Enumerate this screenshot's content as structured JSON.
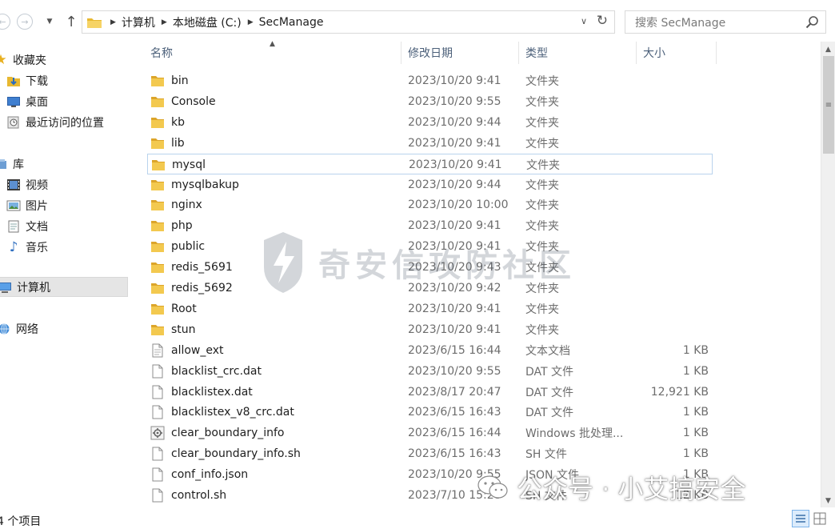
{
  "address": {
    "breadcrumbs": [
      "计算机",
      "本地磁盘 (C:)",
      "SecManage"
    ]
  },
  "search": {
    "placeholder": "搜索 SecManage"
  },
  "nav": {
    "items": [
      {
        "label": "收藏夹",
        "icon": "star-icon"
      },
      {
        "label": "下载",
        "icon": "download-folder-icon"
      },
      {
        "label": "桌面",
        "icon": "desktop-icon"
      },
      {
        "label": "最近访问的位置",
        "icon": "recent-places-icon"
      },
      {
        "label": "库",
        "icon": "library-icon"
      },
      {
        "label": "视频",
        "icon": "video-icon"
      },
      {
        "label": "图片",
        "icon": "pictures-icon"
      },
      {
        "label": "文档",
        "icon": "documents-icon"
      },
      {
        "label": "音乐",
        "icon": "music-icon"
      },
      {
        "label": "计算机",
        "icon": "computer-icon"
      },
      {
        "label": "网络",
        "icon": "network-icon"
      }
    ]
  },
  "columns": {
    "name": "名称",
    "date": "修改日期",
    "type": "类型",
    "size": "大小"
  },
  "files": [
    {
      "name": "bin",
      "date": "2023/10/20 9:41",
      "type": "文件夹",
      "size": "",
      "icon": "folder-icon"
    },
    {
      "name": "Console",
      "date": "2023/10/20 9:55",
      "type": "文件夹",
      "size": "",
      "icon": "folder-icon"
    },
    {
      "name": "kb",
      "date": "2023/10/20 9:44",
      "type": "文件夹",
      "size": "",
      "icon": "folder-icon"
    },
    {
      "name": "lib",
      "date": "2023/10/20 9:41",
      "type": "文件夹",
      "size": "",
      "icon": "folder-icon"
    },
    {
      "name": "mysql",
      "date": "2023/10/20 9:41",
      "type": "文件夹",
      "size": "",
      "icon": "folder-icon",
      "selected": true
    },
    {
      "name": "mysqlbakup",
      "date": "2023/10/20 9:44",
      "type": "文件夹",
      "size": "",
      "icon": "folder-icon"
    },
    {
      "name": "nginx",
      "date": "2023/10/20 10:00",
      "type": "文件夹",
      "size": "",
      "icon": "folder-icon"
    },
    {
      "name": "php",
      "date": "2023/10/20 9:41",
      "type": "文件夹",
      "size": "",
      "icon": "folder-icon"
    },
    {
      "name": "public",
      "date": "2023/10/20 9:41",
      "type": "文件夹",
      "size": "",
      "icon": "folder-icon"
    },
    {
      "name": "redis_5691",
      "date": "2023/10/20 9:43",
      "type": "文件夹",
      "size": "",
      "icon": "folder-icon"
    },
    {
      "name": "redis_5692",
      "date": "2023/10/20 9:42",
      "type": "文件夹",
      "size": "",
      "icon": "folder-icon"
    },
    {
      "name": "Root",
      "date": "2023/10/20 9:41",
      "type": "文件夹",
      "size": "",
      "icon": "folder-icon"
    },
    {
      "name": "stun",
      "date": "2023/10/20 9:41",
      "type": "文件夹",
      "size": "",
      "icon": "folder-icon"
    },
    {
      "name": "allow_ext",
      "date": "2023/6/15 16:44",
      "type": "文本文档",
      "size": "1 KB",
      "icon": "text-file-icon"
    },
    {
      "name": "blacklist_crc.dat",
      "date": "2023/10/20 9:55",
      "type": "DAT 文件",
      "size": "1 KB",
      "icon": "file-icon"
    },
    {
      "name": "blacklistex.dat",
      "date": "2023/8/17 20:47",
      "type": "DAT 文件",
      "size": "12,921 KB",
      "icon": "file-icon"
    },
    {
      "name": "blacklistex_v8_crc.dat",
      "date": "2023/6/15 16:43",
      "type": "DAT 文件",
      "size": "1 KB",
      "icon": "file-icon"
    },
    {
      "name": "clear_boundary_info",
      "date": "2023/6/15 16:44",
      "type": "Windows 批处理...",
      "size": "1 KB",
      "icon": "batch-file-icon"
    },
    {
      "name": "clear_boundary_info.sh",
      "date": "2023/6/15 16:43",
      "type": "SH 文件",
      "size": "1 KB",
      "icon": "file-icon"
    },
    {
      "name": "conf_info.json",
      "date": "2023/10/20 9:55",
      "type": "JSON 文件",
      "size": "1 KB",
      "icon": "file-icon"
    },
    {
      "name": "control.sh",
      "date": "2023/7/10 15:28",
      "type": "SH 文件",
      "size": "12 KB",
      "icon": "file-icon"
    }
  ],
  "status": {
    "count": "4 个项目"
  },
  "watermarks": {
    "center": "奇安信攻防社区",
    "bottom": "公众号 · 小艾搞安全"
  }
}
